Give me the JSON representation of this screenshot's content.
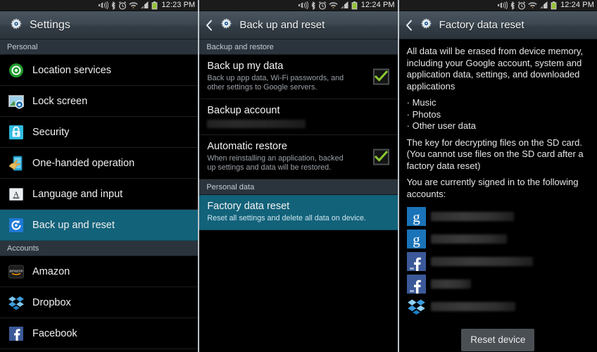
{
  "panels": [
    {
      "statusbar": {
        "time": "12:23 PM",
        "icons": [
          "sound-icon",
          "bluetooth-icon",
          "alarm-icon",
          "wifi-icon",
          "signal-icon",
          "battery-icon"
        ]
      },
      "actionbar": {
        "title": "Settings",
        "icon": "settings-gear-icon",
        "has_back": false
      },
      "sections": [
        {
          "header": "Personal",
          "rows": [
            {
              "label": "Location services",
              "icon": "location-services-icon"
            },
            {
              "label": "Lock screen",
              "icon": "lock-screen-icon"
            },
            {
              "label": "Security",
              "icon": "security-padlock-icon"
            },
            {
              "label": "One-handed operation",
              "icon": "one-handed-operation-icon"
            },
            {
              "label": "Language and input",
              "icon": "language-and-input-icon"
            },
            {
              "label": "Back up and reset",
              "icon": "back-up-and-reset-icon",
              "selected": true
            }
          ]
        },
        {
          "header": "Accounts",
          "rows": [
            {
              "label": "Amazon",
              "icon": "amazon-icon"
            },
            {
              "label": "Dropbox",
              "icon": "dropbox-icon"
            },
            {
              "label": "Facebook",
              "icon": "facebook-icon"
            }
          ]
        }
      ]
    },
    {
      "statusbar": {
        "time": "12:24 PM",
        "icons": [
          "sound-icon",
          "bluetooth-icon",
          "alarm-icon",
          "wifi-icon",
          "signal-icon",
          "battery-icon"
        ]
      },
      "actionbar": {
        "title": "Back up and reset",
        "icon": "settings-gear-icon",
        "has_back": true
      },
      "sections": [
        {
          "header": "Backup and restore",
          "items": [
            {
              "title": "Back up my data",
              "subtitle": "Back up app data, Wi-Fi passwords, and other settings to Google servers.",
              "checkbox": true,
              "checked": true
            },
            {
              "title": "Backup account",
              "redacted_value": true
            },
            {
              "title": "Automatic restore",
              "subtitle": "When reinstalling an application, backed up settings and data will be restored.",
              "checkbox": true,
              "checked": true
            }
          ]
        },
        {
          "header": "Personal data",
          "items": [
            {
              "title": "Factory data reset",
              "subtitle": "Reset all settings and delete all data on device.",
              "selected": true
            }
          ]
        }
      ]
    },
    {
      "statusbar": {
        "time": "12:24 PM",
        "icons": [
          "sound-icon",
          "bluetooth-icon",
          "alarm-icon",
          "wifi-icon",
          "signal-icon",
          "battery-icon"
        ]
      },
      "actionbar": {
        "title": "Factory data reset",
        "icon": "settings-gear-icon",
        "has_back": true
      },
      "body": {
        "paragraph1": "All data will be erased from device memory, including your Google account, system and application data, settings, and downloaded applications",
        "bullets": [
          "· Music",
          "· Photos",
          "· Other user data"
        ],
        "paragraph2": "The key for decrypting files on the SD card. (You cannot use files on the SD card after a factory data reset)",
        "paragraph3": "You are currently signed in to the following accounts:",
        "accounts": [
          {
            "icon": "google-icon",
            "name_redacted": true,
            "width_class": "w1"
          },
          {
            "icon": "google-icon",
            "name_redacted": true,
            "width_class": "w2"
          },
          {
            "icon": "facebook-icon",
            "name_redacted": true,
            "width_class": "w3"
          },
          {
            "icon": "facebook-icon",
            "name_redacted": true,
            "width_class": "w4"
          },
          {
            "icon": "dropbox-icon",
            "name_redacted": true,
            "width_class": "w5"
          }
        ],
        "reset_button": "Reset device"
      }
    }
  ],
  "colors": {
    "selected_row": "#12627a",
    "section_header_bg": "#2b343c",
    "checkbox_check": "#8ac832",
    "battery_green": "#9acd32",
    "accent_blue": "#1a8cd8"
  }
}
